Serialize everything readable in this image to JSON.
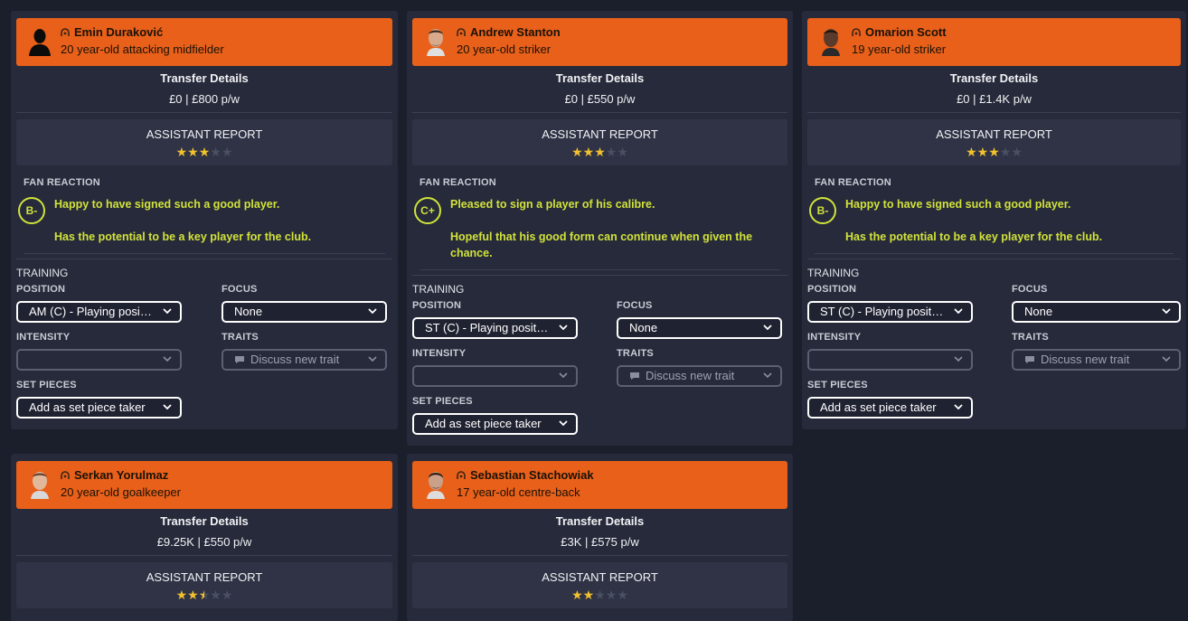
{
  "cards": [
    {
      "name": "Emin Duraković",
      "description": "20 year-old attacking midfielder",
      "transfer_title": "Transfer Details",
      "transfer_value": "£0 | £800 p/w",
      "assistant_report_title": "ASSISTANT REPORT",
      "rating_stars": 3,
      "fan_reaction_label": "FAN REACTION",
      "fan_grade": "B-",
      "fan_reaction_line1": "Happy to have signed such a good player.",
      "fan_reaction_line2": "Has the potential to be a key player for the club.",
      "training_label": "TRAINING",
      "position_label": "POSITION",
      "position_value": "AM (C) - Playing position",
      "focus_label": "FOCUS",
      "focus_value": "None",
      "intensity_label": "INTENSITY",
      "intensity_value": "",
      "traits_label": "TRAITS",
      "traits_value": "Discuss new trait",
      "set_pieces_label": "SET PIECES",
      "set_pieces_value": "Add as set piece taker"
    },
    {
      "name": "Andrew Stanton",
      "description": "20 year-old striker",
      "transfer_title": "Transfer Details",
      "transfer_value": "£0 | £550 p/w",
      "assistant_report_title": "ASSISTANT REPORT",
      "rating_stars": 3,
      "fan_reaction_label": "FAN REACTION",
      "fan_grade": "C+",
      "fan_reaction_line1": "Pleased to sign a player of his calibre.",
      "fan_reaction_line2": "Hopeful that his good form can continue when given the chance.",
      "training_label": "TRAINING",
      "position_label": "POSITION",
      "position_value": "ST (C) - Playing position",
      "focus_label": "FOCUS",
      "focus_value": "None",
      "intensity_label": "INTENSITY",
      "intensity_value": "",
      "traits_label": "TRAITS",
      "traits_value": "Discuss new trait",
      "set_pieces_label": "SET PIECES",
      "set_pieces_value": "Add as set piece taker"
    },
    {
      "name": "Omarion Scott",
      "description": "19 year-old striker",
      "transfer_title": "Transfer Details",
      "transfer_value": "£0 | £1.4K p/w",
      "assistant_report_title": "ASSISTANT REPORT",
      "rating_stars": 3,
      "fan_reaction_label": "FAN REACTION",
      "fan_grade": "B-",
      "fan_reaction_line1": "Happy to have signed such a good player.",
      "fan_reaction_line2": "Has the potential to be a key player for the club.",
      "training_label": "TRAINING",
      "position_label": "POSITION",
      "position_value": "ST (C) - Playing position",
      "focus_label": "FOCUS",
      "focus_value": "None",
      "intensity_label": "INTENSITY",
      "intensity_value": "",
      "traits_label": "TRAITS",
      "traits_value": "Discuss new trait",
      "set_pieces_label": "SET PIECES",
      "set_pieces_value": "Add as set piece taker"
    },
    {
      "name": "Serkan Yorulmaz",
      "description": "20 year-old goalkeeper",
      "transfer_title": "Transfer Details",
      "transfer_value": "£9.25K | £550 p/w",
      "assistant_report_title": "ASSISTANT REPORT",
      "rating_stars": 2.5
    },
    {
      "name": "Sebastian Stachowiak",
      "description": "17 year-old centre-back",
      "transfer_title": "Transfer Details",
      "transfer_value": "£3K | £575 p/w",
      "assistant_report_title": "ASSISTANT REPORT",
      "rating_stars": 2
    }
  ],
  "rating_max": 5,
  "colors": {
    "background": "#1b1e2b",
    "card": "#262a3a",
    "header": "#e8601a",
    "star": "#f2c12e",
    "fan_text": "#d2e23a"
  }
}
